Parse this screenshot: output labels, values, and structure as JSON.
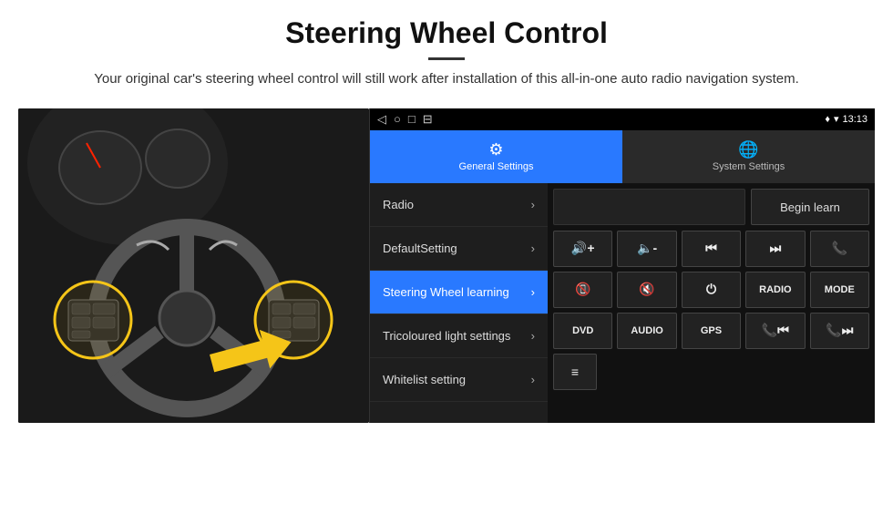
{
  "header": {
    "title": "Steering Wheel Control",
    "divider": true,
    "subtitle": "Your original car's steering wheel control will still work after installation of this all-in-one auto radio navigation system."
  },
  "status_bar": {
    "nav_icons": [
      "◁",
      "○",
      "□",
      "⊟"
    ],
    "right_icons": "♦ ▾",
    "time": "13:13"
  },
  "tabs": [
    {
      "id": "general",
      "icon": "⚙",
      "label": "General Settings",
      "active": true
    },
    {
      "id": "system",
      "icon": "🌐",
      "label": "System Settings",
      "active": false
    }
  ],
  "menu_items": [
    {
      "id": "radio",
      "label": "Radio",
      "active": false
    },
    {
      "id": "default",
      "label": "DefaultSetting",
      "active": false
    },
    {
      "id": "steering",
      "label": "Steering Wheel learning",
      "active": true
    },
    {
      "id": "tricoloured",
      "label": "Tricoloured light settings",
      "active": false
    },
    {
      "id": "whitelist",
      "label": "Whitelist setting",
      "active": false
    }
  ],
  "control_panel": {
    "begin_learn_label": "Begin learn",
    "buttons_row1": [
      {
        "id": "vol-up",
        "label": "🔊+"
      },
      {
        "id": "vol-down",
        "label": "🔈-"
      },
      {
        "id": "prev-track",
        "label": "⏮"
      },
      {
        "id": "next-track",
        "label": "⏭"
      },
      {
        "id": "phone",
        "label": "📞"
      }
    ],
    "buttons_row2": [
      {
        "id": "hang-up",
        "label": "☎"
      },
      {
        "id": "mute",
        "label": "🔇"
      },
      {
        "id": "power",
        "label": "⏻"
      },
      {
        "id": "radio-btn",
        "label": "RADIO"
      },
      {
        "id": "mode-btn",
        "label": "MODE"
      }
    ],
    "buttons_row3": [
      {
        "id": "dvd",
        "label": "DVD"
      },
      {
        "id": "audio",
        "label": "AUDIO"
      },
      {
        "id": "gps",
        "label": "GPS"
      },
      {
        "id": "tel-prev",
        "label": "📞⏮"
      },
      {
        "id": "tel-next",
        "label": "📞⏭"
      }
    ],
    "buttons_row4": [
      {
        "id": "list-icon",
        "label": "≡"
      }
    ]
  }
}
